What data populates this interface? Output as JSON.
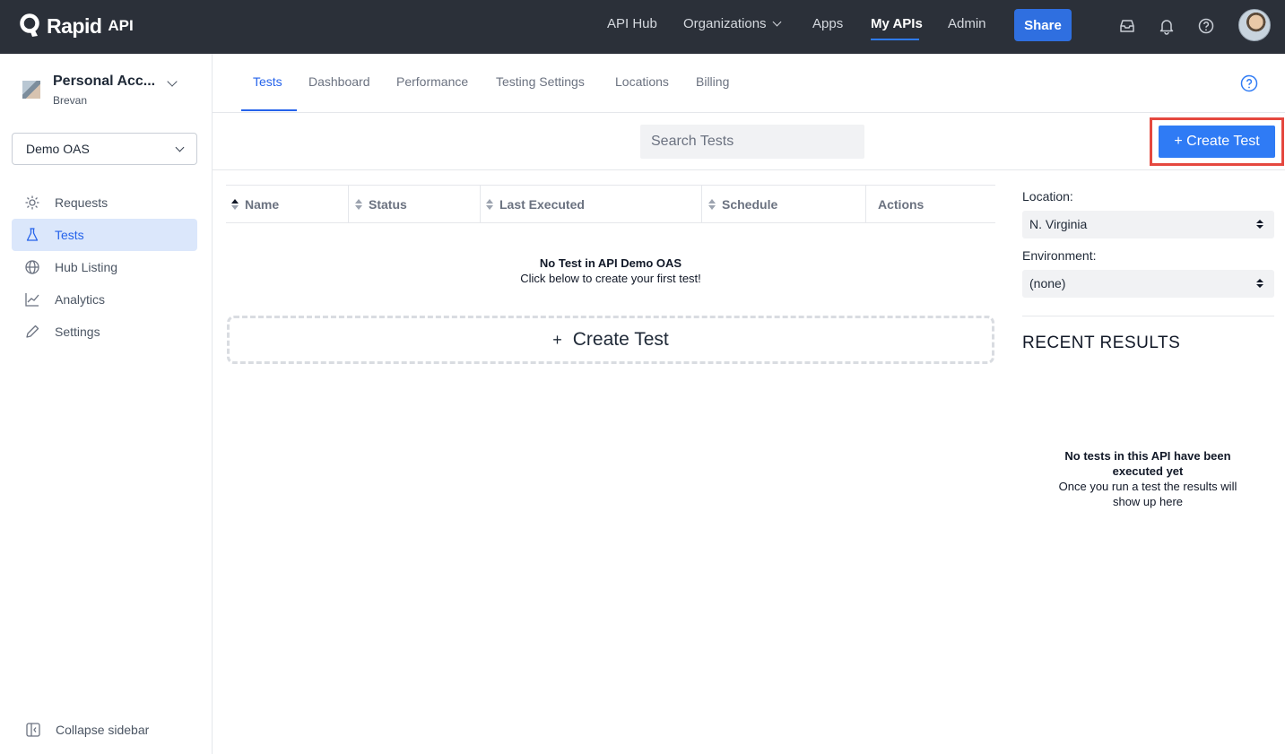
{
  "brand": {
    "name": "Rapid",
    "suffix": "API"
  },
  "topnav": {
    "items": [
      {
        "label": "API Hub"
      },
      {
        "label": "Organizations"
      },
      {
        "label": "Apps"
      },
      {
        "label": "My APIs"
      },
      {
        "label": "Admin"
      }
    ],
    "share_label": "Share",
    "icons": [
      "inbox-icon",
      "bell-icon",
      "help-icon"
    ]
  },
  "sidebar": {
    "account_name": "Personal Acc...",
    "account_sub": "Brevan",
    "api_select": "Demo OAS",
    "items": [
      {
        "label": "Requests",
        "icon": "requests-icon"
      },
      {
        "label": "Tests",
        "icon": "flask-icon"
      },
      {
        "label": "Hub Listing",
        "icon": "globe-icon"
      },
      {
        "label": "Analytics",
        "icon": "chart-icon"
      },
      {
        "label": "Settings",
        "icon": "pencil-icon"
      }
    ],
    "collapse_label": "Collapse sidebar"
  },
  "tabs": [
    {
      "label": "Tests"
    },
    {
      "label": "Dashboard"
    },
    {
      "label": "Performance"
    },
    {
      "label": "Testing Settings"
    },
    {
      "label": "Locations"
    },
    {
      "label": "Billing"
    }
  ],
  "toolbar": {
    "search_placeholder": "Search Tests",
    "create_label": "+ Create Test"
  },
  "table": {
    "columns": [
      "Name",
      "Status",
      "Last Executed",
      "Schedule",
      "Actions"
    ],
    "empty_title": "No Test in API Demo OAS",
    "empty_sub": "Click below to create your first test!",
    "create_plus": "+",
    "create_label": "Create Test"
  },
  "right_panel": {
    "location_label": "Location:",
    "location_value": "N. Virginia",
    "environment_label": "Environment:",
    "environment_value": "(none)",
    "recent_title": "RECENT RESULTS",
    "recent_empty_title": "No tests in this API have been executed yet",
    "recent_empty_sub": "Once you run a test the results will show up here"
  },
  "colors": {
    "topbar": "#2b3039",
    "accent": "#2f7bf5",
    "highlight": "#e5483f",
    "sidebar_active_bg": "#dbe7fb"
  }
}
